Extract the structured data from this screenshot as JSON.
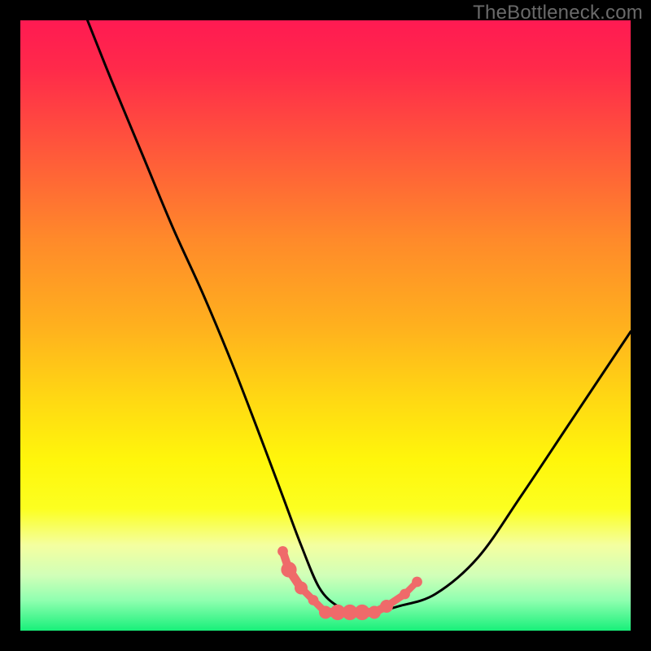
{
  "watermark": "TheBottleneck.com",
  "chart_data": {
    "type": "line",
    "title": "",
    "xlabel": "",
    "ylabel": "",
    "xlim": [
      0,
      100
    ],
    "ylim": [
      0,
      100
    ],
    "grid": false,
    "legend": false,
    "series": [
      {
        "name": "bottleneck-curve",
        "color": "#000000",
        "x": [
          11,
          15,
          20,
          25,
          30,
          35,
          40,
          43,
          46,
          49,
          52,
          55,
          58,
          62,
          68,
          75,
          82,
          90,
          98,
          100
        ],
        "y": [
          100,
          90,
          78,
          66,
          55,
          43,
          30,
          22,
          14,
          7,
          4,
          3,
          3,
          4,
          6,
          12,
          22,
          34,
          46,
          49
        ]
      },
      {
        "name": "marker-cluster",
        "color": "#ef6a6a",
        "type": "scatter",
        "points": [
          {
            "x": 43,
            "y": 13,
            "r": 4
          },
          {
            "x": 44,
            "y": 10,
            "r": 6
          },
          {
            "x": 46,
            "y": 7,
            "r": 5
          },
          {
            "x": 48,
            "y": 5,
            "r": 4
          },
          {
            "x": 50,
            "y": 3,
            "r": 5
          },
          {
            "x": 52,
            "y": 3,
            "r": 6
          },
          {
            "x": 54,
            "y": 3,
            "r": 6
          },
          {
            "x": 56,
            "y": 3,
            "r": 6
          },
          {
            "x": 58,
            "y": 3,
            "r": 5
          },
          {
            "x": 60,
            "y": 4,
            "r": 5
          },
          {
            "x": 63,
            "y": 6,
            "r": 4
          },
          {
            "x": 65,
            "y": 8,
            "r": 4
          }
        ]
      }
    ],
    "background_gradient": {
      "top": "#ff1a52",
      "mid": "#ffe010",
      "bottom": "#18f07a"
    }
  }
}
